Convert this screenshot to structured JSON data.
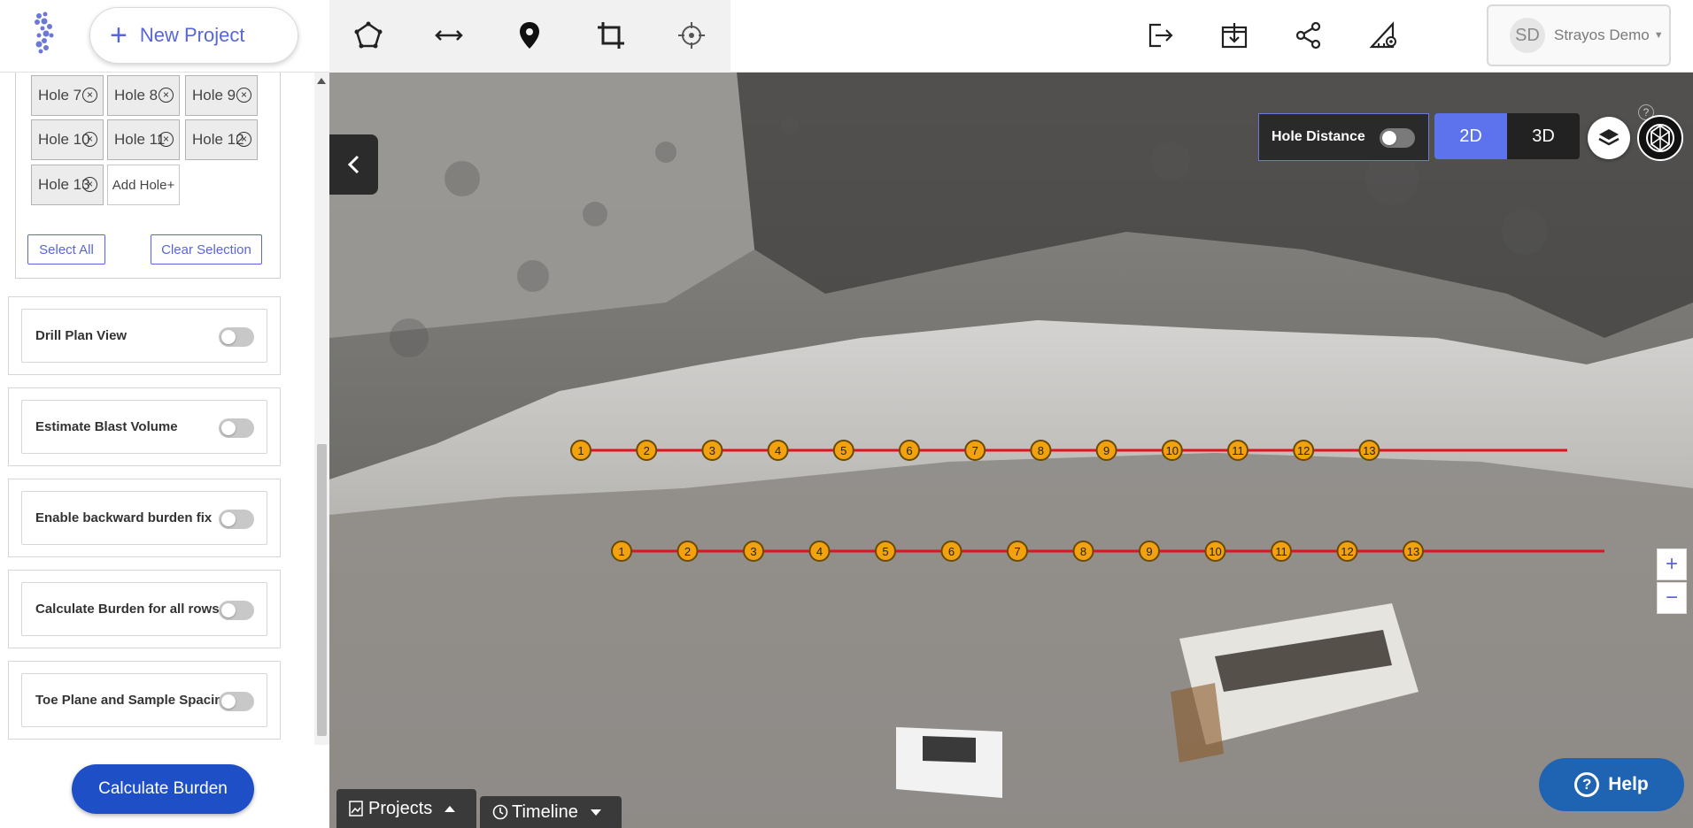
{
  "header": {
    "new_project_label": "New Project",
    "tools": [
      "polygon-icon",
      "measure-distance-icon",
      "location-pin-icon",
      "crop-icon",
      "target-icon"
    ],
    "right_tools": [
      "export-icon",
      "download-icon",
      "share-icon",
      "settings-triangle-icon"
    ],
    "user": {
      "initials": "SD",
      "name": "Strayos Demo"
    }
  },
  "sidebar": {
    "holes": [
      "Hole 7",
      "Hole 8",
      "Hole 9",
      "Hole 10",
      "Hole 11",
      "Hole 12",
      "Hole 13"
    ],
    "add_hole_label": "Add Hole+",
    "select_all_label": "Select All",
    "clear_selection_label": "Clear Selection",
    "options": [
      {
        "label": "Drill Plan View",
        "enabled": false
      },
      {
        "label": "Estimate Blast Volume",
        "enabled": false
      },
      {
        "label": "Enable backward burden fix",
        "enabled": false
      },
      {
        "label": "Calculate Burden for all rows",
        "enabled": false
      },
      {
        "label": "Toe Plane and Sample Spacing",
        "enabled": false
      }
    ],
    "calculate_label": "Calculate Burden"
  },
  "map": {
    "hole_distance_label": "Hole Distance",
    "hole_distance_enabled": false,
    "view_2d_label": "2D",
    "view_3d_label": "3D",
    "active_view": "2D",
    "help_qmark": "?",
    "zoom_in_label": "+",
    "zoom_out_label": "−",
    "help_label": "Help",
    "projects_label": "Projects",
    "timeline_label": "Timeline",
    "row1_holes": [
      "1",
      "2",
      "3",
      "4",
      "5",
      "6",
      "7",
      "8",
      "9",
      "10",
      "11",
      "12",
      "13"
    ],
    "row2_holes": [
      "1",
      "2",
      "3",
      "4",
      "5",
      "6",
      "7",
      "8",
      "9",
      "10",
      "11",
      "12",
      "13"
    ],
    "colors": {
      "accent": "#5866d7",
      "drill_line": "#e0141e",
      "hole_marker": "#f2a10f",
      "active_view": "#5d73ee",
      "help": "#1f63b3"
    }
  }
}
